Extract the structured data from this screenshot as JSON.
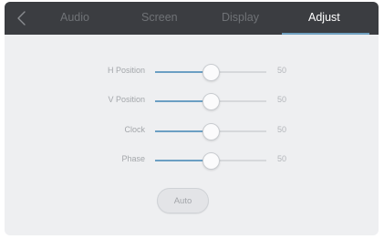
{
  "header": {
    "back_icon": "chevron-left-icon",
    "tabs": [
      {
        "label": "Audio",
        "active": false
      },
      {
        "label": "Screen",
        "active": false
      },
      {
        "label": "Display",
        "active": false
      },
      {
        "label": "Adjust",
        "active": true
      }
    ]
  },
  "adjust": {
    "sliders": [
      {
        "label": "H Position",
        "value": "50",
        "level": 50
      },
      {
        "label": "V Position",
        "value": "50",
        "level": 50
      },
      {
        "label": "Clock",
        "value": "50",
        "level": 50
      },
      {
        "label": "Phase",
        "value": "50",
        "level": 50
      }
    ],
    "auto_button": "Auto"
  },
  "colors": {
    "header_bg": "#3b3d41",
    "panel_bg": "#eeeff1",
    "accent": "#6b9fc3",
    "active_tab_text": "#ffffff",
    "inactive_tab_text": "#6f7276"
  }
}
